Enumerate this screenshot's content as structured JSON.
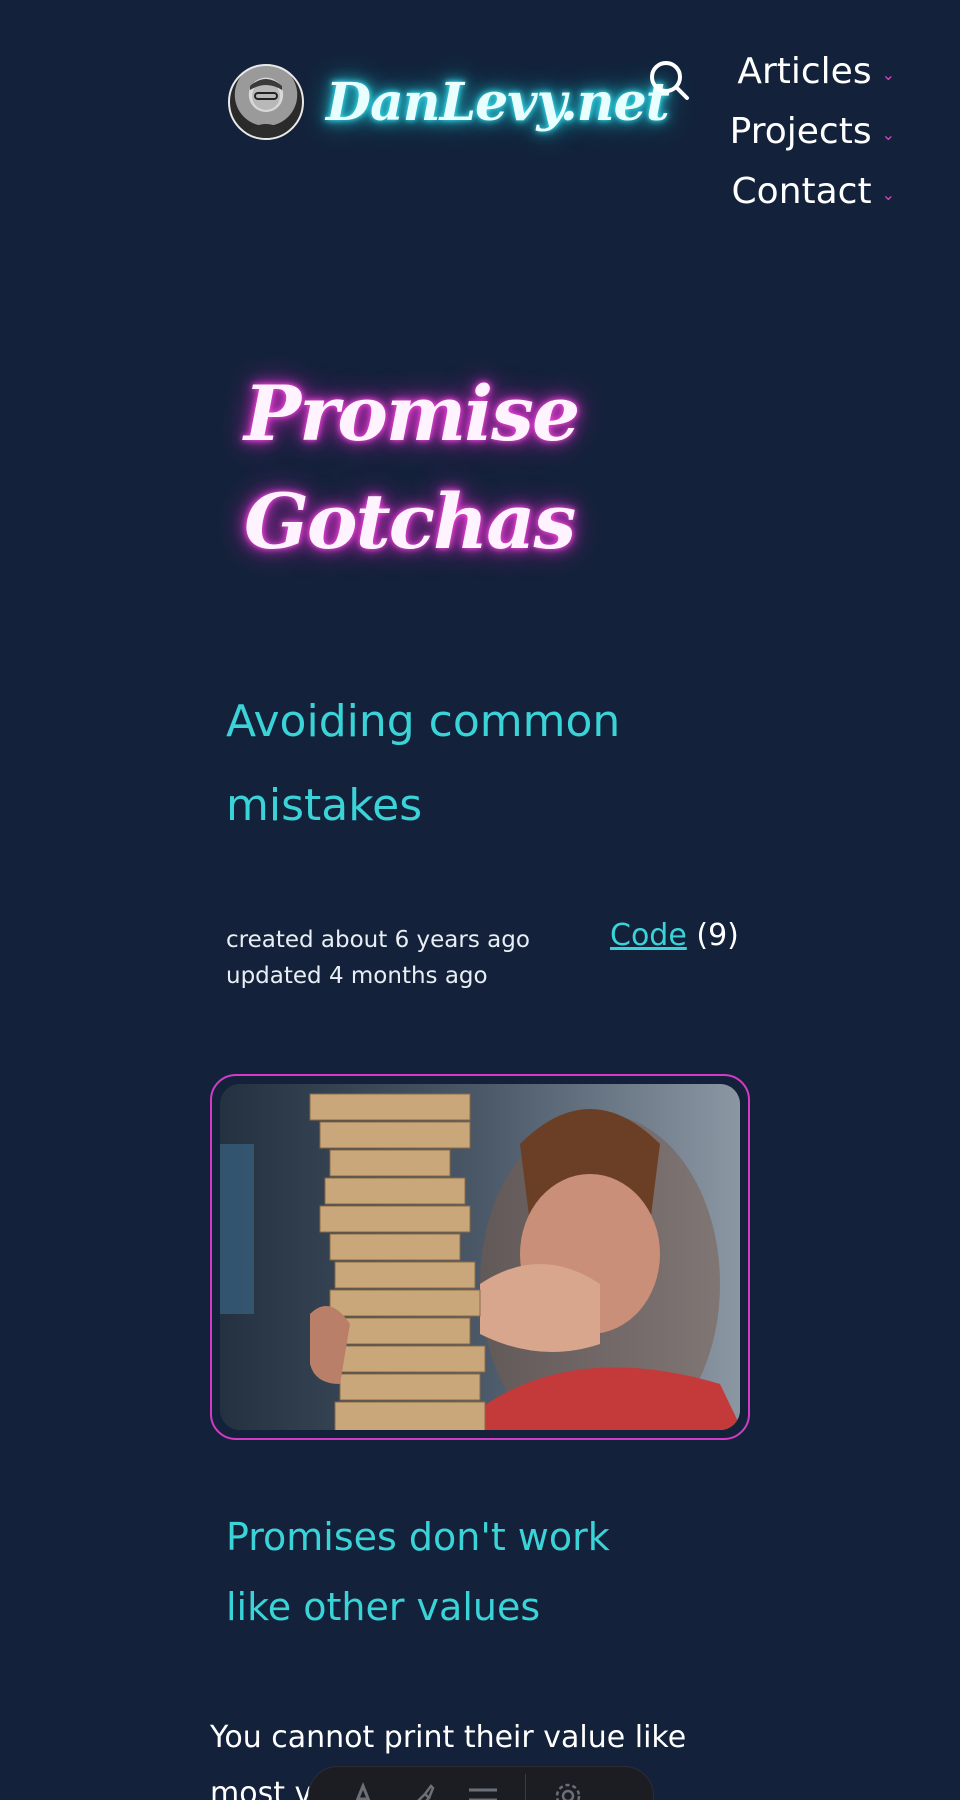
{
  "header": {
    "site_title": "DanLevy.net",
    "avatar_alt": "avatar",
    "search_icon": "search-icon",
    "nav": [
      {
        "label": "Articles",
        "icon": "chevron-down-icon"
      },
      {
        "label": "Projects",
        "icon": "chevron-down-icon"
      },
      {
        "label": "Contact",
        "icon": "chevron-down-icon"
      }
    ]
  },
  "post": {
    "title_line1": "Promise",
    "title_line2": "Gotchas",
    "subtitle": "Avoiding common mistakes",
    "created": "created about 6 years ago",
    "updated": "updated 4 months ago",
    "category_link": "Code",
    "category_count": "(9)",
    "section_heading": "Promises don't work like other values",
    "body_text": "You cannot print their value like most v"
  },
  "theme": {
    "background": "#13223a",
    "accent_cyan": "#3ad3d8",
    "accent_magenta": "#e23fc9"
  },
  "toolbar": {
    "icons": [
      "text-size-icon",
      "brush-icon",
      "menu-icon",
      "settings-icon"
    ]
  }
}
